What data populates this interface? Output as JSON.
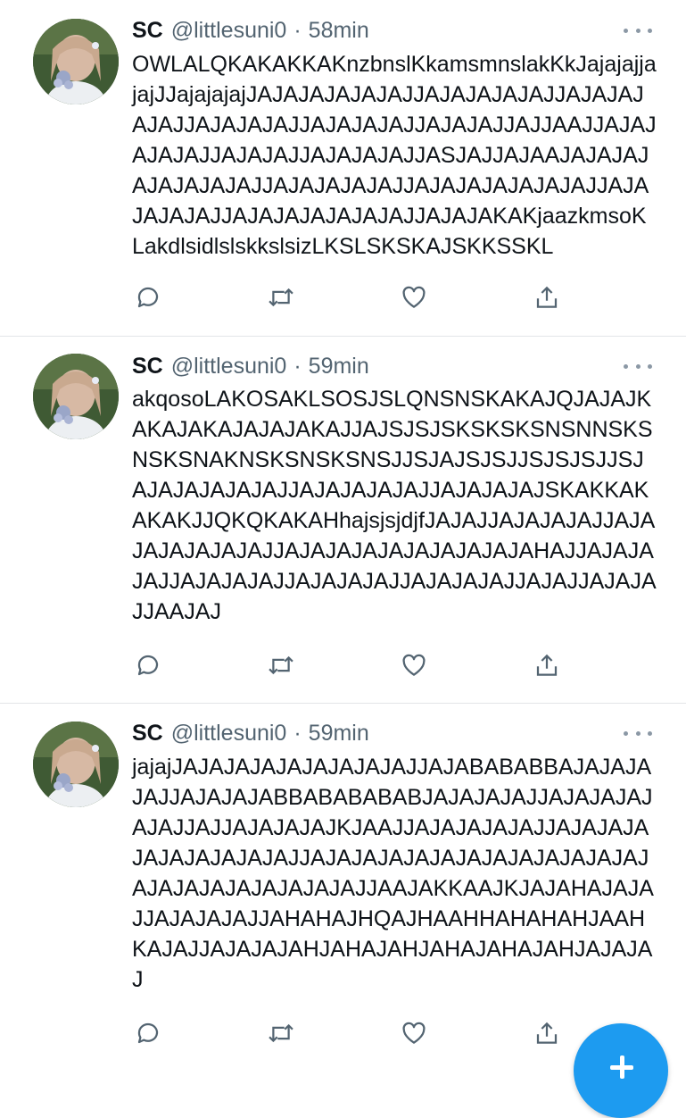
{
  "theme": {
    "accent": "#1d9bf0",
    "text": "#0f1419",
    "muted": "#536471",
    "icon": "#536471",
    "divider": "#e3e5e8"
  },
  "tweets": [
    {
      "name": "SC",
      "handle": "@littlesuni0",
      "separator": "·",
      "time": "58min",
      "text": "OWLALQKAKAKKAKnzbnslKkamsmnslakKkJajajajjajajJJajajajajJAJAJAJAJAJAJJAJAJAJAJAJJAJAJAJAJAJJAJAJAJAJJAJAJAJAJJAJAJAJJAJJAAJJAJAJAJAJAJJAJAJAJJAJAJAJAJJASJAJJAJAAJAJAJAJAJAJAJAJAJJAJAJAJAJAJJAJAJAJAJAJAJAJJAJAJAJAJAJJAJAJAJAJAJAJAJJAJAJAKAKjaazkmsoKLakdlsidlslskkslsizLKSLSKSKAJSKKSSKL",
      "icons": [
        "reply-icon",
        "retweet-icon",
        "like-icon",
        "share-icon"
      ]
    },
    {
      "name": "SC",
      "handle": "@littlesuni0",
      "separator": "·",
      "time": "59min",
      "text": "akqosoLAKOSAKLSOSJSLQNSNSKAKAJQJAJAJKAKAJAKAJAJAJAKAJJAJSJSJSKSKSKSNSNNSKSNSKSNAKNSKSNSKSNSJJSJAJSJSJJSJSJSJJSJAJAJAJAJAJAJJAJAJAJAJAJJAJAJAJAJSKAKKAKAKAKJJQKQKAKAHhajsjsjdjfJAJAJJAJAJAJAJJAJAJAJAJAJAJAJJAJAJAJAJAJAJAJAJAJAHAJJAJAJAJAJJAJAJAJAJJAJAJAJAJJAJAJAJAJJAJAJJAJAJAJJAAJAJ",
      "icons": [
        "reply-icon",
        "retweet-icon",
        "like-icon",
        "share-icon"
      ]
    },
    {
      "name": "SC",
      "handle": "@littlesuni0",
      "separator": "·",
      "time": "59min",
      "text": "jajajJAJAJAJAJAJAJAJAJAJJAJABABABBAJAJAJAJAJJAJAJAJABBABABABABJAJAJAJAJJAJAJAJAJAJAJJAJJAJAJAJAJKJAAJJAJAJAJAJAJJAJAJAJAJAJAJAJAJAJAJJAJAJAJAJAJAJAJAJAJAJAJAJAJAJAJAJAJAJAJAJAJAJJAAJAKKAAJKJAJAHAJAJAJJAJAJAJAJJAHAHAJHQAJHAAHHAHAHAHJAAHKAJAJJAJAJAJAHJAHAJAHJAHAJAHAJAHJAJAJAJ",
      "icons": [
        "reply-icon",
        "retweet-icon",
        "like-icon",
        "share-icon"
      ]
    }
  ],
  "fab": {
    "icon": "plus-icon"
  }
}
